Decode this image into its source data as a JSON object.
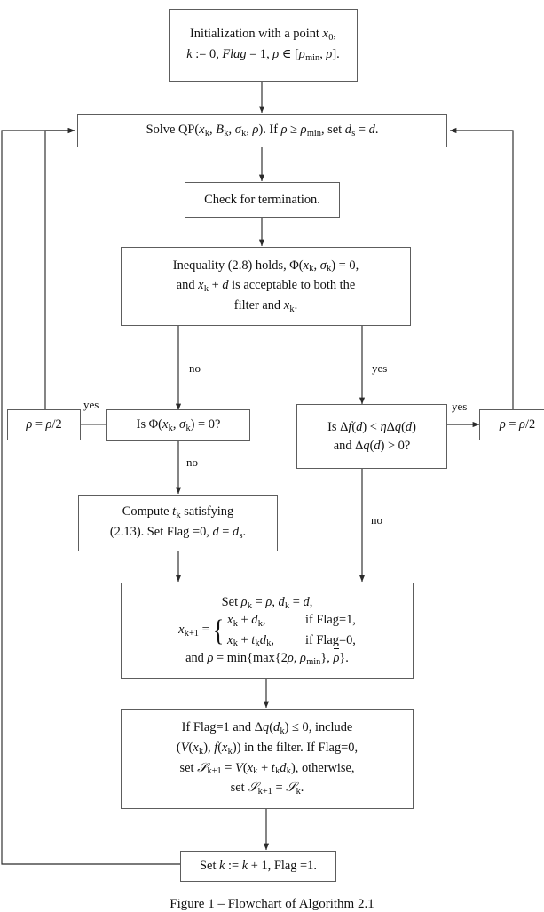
{
  "figure": {
    "caption": "Figure 1 – Flowchart of Algorithm 2.1",
    "line_color": "#5d5d5d",
    "text_color": "#111111",
    "background": "#ffffff"
  },
  "nodes": {
    "init": {
      "id": "initialization",
      "lines": [
        "Initialization with a point x0,",
        "k := 0, Flag = 1, ρ ∈ [ρmin, ρ̄]."
      ]
    },
    "solve_qp": {
      "id": "solve-qp",
      "lines": [
        "Solve QP(xk, Bk, σk, ρ). If ρ ≥ ρmin, set ds = d."
      ]
    },
    "check_termination": {
      "id": "check-termination",
      "lines": [
        "Check for termination."
      ]
    },
    "inequality": {
      "id": "inequality-condition",
      "lines": [
        "Inequality (2.8) holds, Φ(xk, σk) = 0,",
        "and xk + d is acceptable to both the",
        "filter and xk."
      ]
    },
    "rho_half_left": {
      "id": "rho-half-left",
      "lines": [
        "ρ = ρ/2"
      ]
    },
    "is_phi_zero": {
      "id": "is-phi-zero",
      "lines": [
        "Is Φ(xk, σk) = 0?"
      ]
    },
    "is_delta_f": {
      "id": "is-delta-f",
      "lines": [
        "Is Δf(d) < ηΔq(d)",
        "and Δq(d) > 0?"
      ]
    },
    "rho_half_right": {
      "id": "rho-half-right",
      "lines": [
        "ρ = ρ/2"
      ]
    },
    "compute_tk": {
      "id": "compute-tk",
      "lines": [
        "Compute tk satisfying",
        "(2.13). Set Flag =0, d = ds."
      ]
    },
    "set_rho_k": {
      "id": "set-rho-k",
      "line1": "Set ρk = ρ, dk = d,",
      "lhs": "xk+1 =",
      "case1_value": "xk + dk,",
      "case1_cond": "if Flag=1,",
      "case2_value": "xk + tkdk,",
      "case2_cond": "if Flag=0,",
      "line_last": "and ρ = min{max{2ρ, ρmin}, ρ̄}."
    },
    "filter_update": {
      "id": "filter-update",
      "lines": [
        "If Flag=1 and Δq(dk) ≤ 0, include",
        "(V(xk), f(xk)) in the filter. If Flag=0,",
        "set Uk+1 = V(xk + tkdk), otherwise,",
        "set Uk+1 = Uk."
      ]
    },
    "increment_k": {
      "id": "increment-k",
      "lines": [
        "Set k := k + 1, Flag =1."
      ]
    }
  },
  "edge_labels": {
    "inequality_no": "no",
    "inequality_yes": "yes",
    "phi_yes": "yes",
    "phi_no": "no",
    "delta_f_yes": "yes",
    "delta_f_no": "no"
  }
}
